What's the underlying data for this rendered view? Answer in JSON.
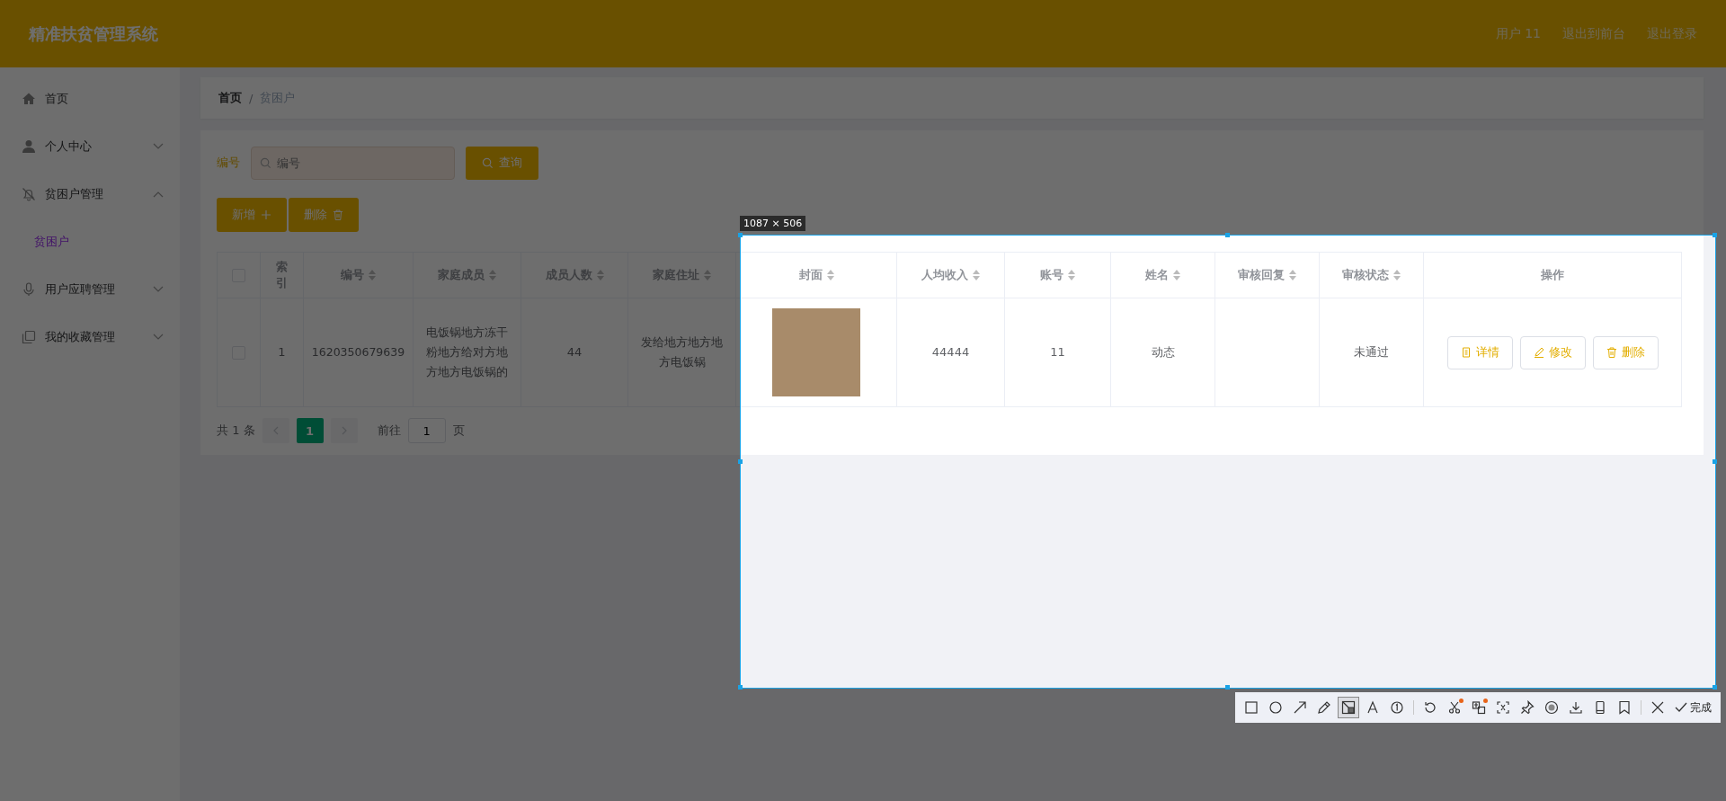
{
  "header": {
    "title": "精准扶贫管理系统",
    "links": [
      "用户 11",
      "退出到前台",
      "退出登录"
    ]
  },
  "sidebar": {
    "items": [
      {
        "label": "首页",
        "selected": false
      },
      {
        "label": "个人中心",
        "selected": false,
        "expanded": false
      },
      {
        "label": "贫困户管理",
        "selected": false,
        "expanded": true,
        "children": [
          {
            "label": "贫困户",
            "selected": true
          }
        ]
      },
      {
        "label": "用户应聘管理",
        "selected": false,
        "expanded": false
      },
      {
        "label": "我的收藏管理",
        "selected": false,
        "expanded": false
      }
    ]
  },
  "breadcrumb": {
    "items": [
      "首页",
      "贫困户"
    ],
    "separator": "/"
  },
  "search": {
    "label": "编号",
    "placeholder": "编号",
    "button": "查询"
  },
  "actions": [
    "新增",
    "删除"
  ],
  "table": {
    "columns": [
      {
        "kind": "checkbox",
        "checked": false
      },
      {
        "kind": "text",
        "label": "索引",
        "sortable": false
      },
      {
        "kind": "text",
        "label": "编号",
        "sortable": true
      },
      {
        "kind": "text",
        "label": "家庭成员",
        "sortable": true
      },
      {
        "kind": "text",
        "label": "成员人数",
        "sortable": true
      },
      {
        "kind": "text",
        "label": "家庭住址",
        "sortable": true
      },
      {
        "kind": "text",
        "label": "封面",
        "sortable": true
      },
      {
        "kind": "text",
        "label": "人均收入",
        "sortable": true
      },
      {
        "kind": "text",
        "label": "账号",
        "sortable": true
      },
      {
        "kind": "text",
        "label": "姓名",
        "sortable": true
      },
      {
        "kind": "text",
        "label": "审核回复",
        "sortable": true
      },
      {
        "kind": "text",
        "label": "审核状态",
        "sortable": true
      },
      {
        "kind": "text",
        "label": "操作",
        "sortable": false
      }
    ],
    "rows": [
      {
        "cells": [
          {
            "kind": "checkbox",
            "checked": false
          },
          {
            "kind": "text",
            "text": "1"
          },
          {
            "kind": "text",
            "text": "1620350679639"
          },
          {
            "kind": "text",
            "text": "电饭锅地方冻干粉地方给对方地方地方电饭锅的"
          },
          {
            "kind": "text",
            "text": "44"
          },
          {
            "kind": "text",
            "text": "发给地方地方地方电饭锅"
          },
          {
            "kind": "photo"
          },
          {
            "kind": "text",
            "text": "44444"
          },
          {
            "kind": "text",
            "text": "11"
          },
          {
            "kind": "text",
            "text": "动态"
          },
          {
            "kind": "blank"
          },
          {
            "kind": "text",
            "text": "未通过"
          },
          {
            "kind": "actions",
            "buttons": [
              "详情",
              "修改",
              "删除"
            ]
          }
        ]
      }
    ]
  },
  "pagination": {
    "total": "共 1 条",
    "pages": [
      {
        "label": "1",
        "selected": true
      }
    ],
    "goto_label": "前往",
    "goto_value": "1",
    "goto_suffix": "页"
  },
  "capture": {
    "size_label": "1087 × 506",
    "tools": [
      {
        "selected": false,
        "dot": false
      },
      {
        "selected": false,
        "dot": false
      },
      {
        "selected": false,
        "dot": false
      },
      {
        "selected": false,
        "dot": false
      },
      {
        "selected": true,
        "dot": false
      },
      {
        "selected": false,
        "dot": false
      },
      {
        "selected": false,
        "dot": false
      },
      {
        "selected": false,
        "dot": false
      },
      {
        "selected": false,
        "dot": true
      },
      {
        "selected": false,
        "dot": true
      },
      {
        "selected": false,
        "dot": false
      },
      {
        "selected": false,
        "dot": false
      },
      {
        "selected": false,
        "dot": false
      },
      {
        "selected": false,
        "dot": false
      },
      {
        "selected": false,
        "dot": false
      },
      {
        "selected": false,
        "dot": false
      }
    ],
    "done": "完成"
  }
}
